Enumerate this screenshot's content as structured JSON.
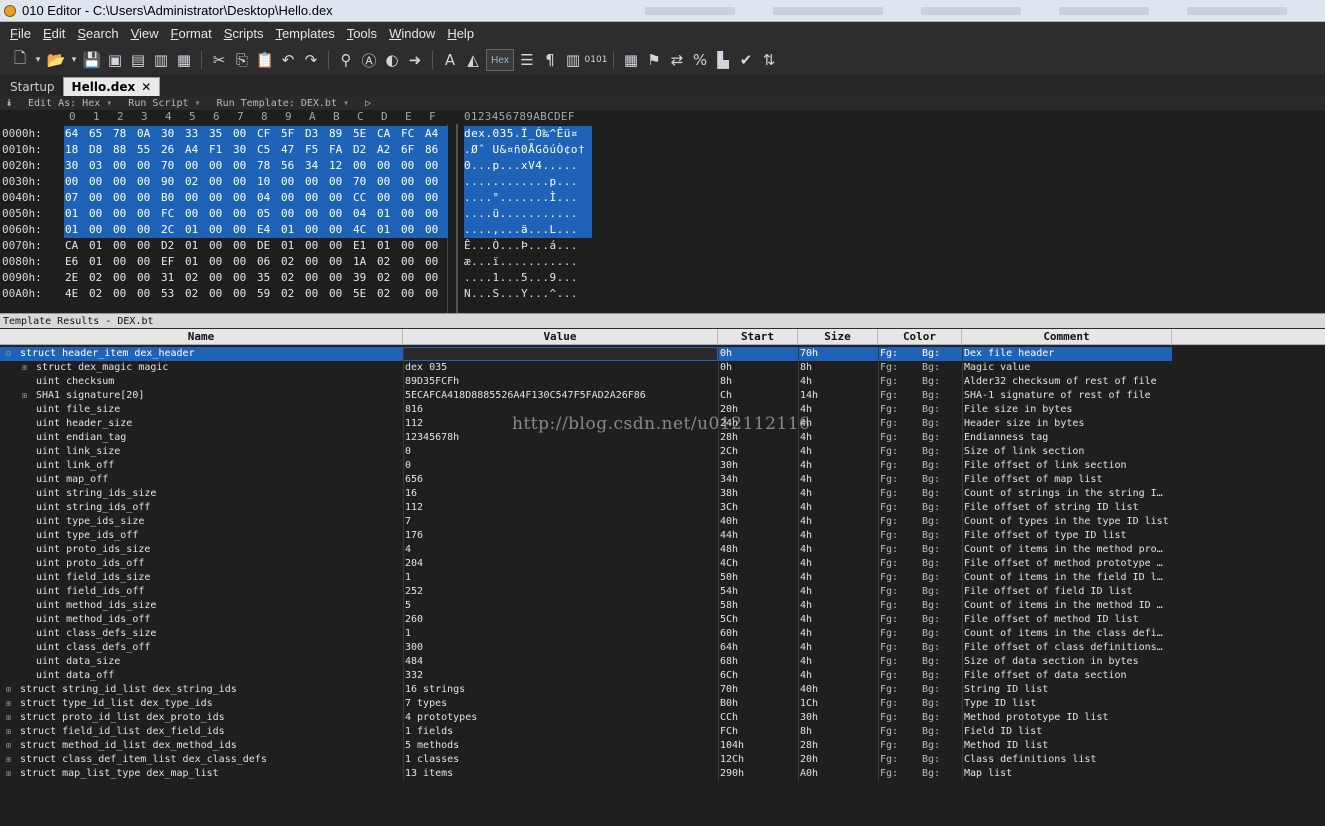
{
  "window": {
    "title": "010 Editor - C:\\Users\\Administrator\\Desktop\\Hello.dex"
  },
  "menu": [
    "File",
    "Edit",
    "Search",
    "View",
    "Format",
    "Scripts",
    "Templates",
    "Tools",
    "Window",
    "Help"
  ],
  "toolbar": {
    "hex_label": "Hex"
  },
  "tabs": [
    {
      "label": "Startup"
    },
    {
      "label": "Hello.dex",
      "active": true
    }
  ],
  "editbar": {
    "edit_as": "Edit As: Hex",
    "run_script": "Run Script",
    "run_template": "Run Template: DEX.bt"
  },
  "hex": {
    "columns": [
      "0",
      "1",
      "2",
      "3",
      "4",
      "5",
      "6",
      "7",
      "8",
      "9",
      "A",
      "B",
      "C",
      "D",
      "E",
      "F"
    ],
    "ascii_header": "0123456789ABCDEF",
    "rows": [
      {
        "addr": "0000h:",
        "bytes": [
          "64",
          "65",
          "78",
          "0A",
          "30",
          "33",
          "35",
          "00",
          "CF",
          "5F",
          "D3",
          "89",
          "5E",
          "CA",
          "FC",
          "A4"
        ],
        "ascii": "dex.035.Ï_Ó‰^Êü¤",
        "sel": true
      },
      {
        "addr": "0010h:",
        "bytes": [
          "18",
          "D8",
          "88",
          "55",
          "26",
          "A4",
          "F1",
          "30",
          "C5",
          "47",
          "F5",
          "FA",
          "D2",
          "A2",
          "6F",
          "86"
        ],
        "ascii": ".Øˆ U&¤ñ0ÅGõúÒ¢o†",
        "sel": true
      },
      {
        "addr": "0020h:",
        "bytes": [
          "30",
          "03",
          "00",
          "00",
          "70",
          "00",
          "00",
          "00",
          "78",
          "56",
          "34",
          "12",
          "00",
          "00",
          "00",
          "00"
        ],
        "ascii": "0...p...xV4.....",
        "sel": true
      },
      {
        "addr": "0030h:",
        "bytes": [
          "00",
          "00",
          "00",
          "00",
          "90",
          "02",
          "00",
          "00",
          "10",
          "00",
          "00",
          "00",
          "70",
          "00",
          "00",
          "00"
        ],
        "ascii": "............p...",
        "sel": true
      },
      {
        "addr": "0040h:",
        "bytes": [
          "07",
          "00",
          "00",
          "00",
          "B0",
          "00",
          "00",
          "00",
          "04",
          "00",
          "00",
          "00",
          "CC",
          "00",
          "00",
          "00"
        ],
        "ascii": "....°.......Ì...",
        "sel": true
      },
      {
        "addr": "0050h:",
        "bytes": [
          "01",
          "00",
          "00",
          "00",
          "FC",
          "00",
          "00",
          "00",
          "05",
          "00",
          "00",
          "00",
          "04",
          "01",
          "00",
          "00"
        ],
        "ascii": "....ü...........",
        "sel": true
      },
      {
        "addr": "0060h:",
        "bytes": [
          "01",
          "00",
          "00",
          "00",
          "2C",
          "01",
          "00",
          "00",
          "E4",
          "01",
          "00",
          "00",
          "4C",
          "01",
          "00",
          "00"
        ],
        "ascii": "....,...ä...L...",
        "sel": true
      },
      {
        "addr": "0070h:",
        "bytes": [
          "CA",
          "01",
          "00",
          "00",
          "D2",
          "01",
          "00",
          "00",
          "DE",
          "01",
          "00",
          "00",
          "E1",
          "01",
          "00",
          "00"
        ],
        "ascii": "Ê...Ò...Þ...á...",
        "sel": false
      },
      {
        "addr": "0080h:",
        "bytes": [
          "E6",
          "01",
          "00",
          "00",
          "EF",
          "01",
          "00",
          "00",
          "06",
          "02",
          "00",
          "00",
          "1A",
          "02",
          "00",
          "00"
        ],
        "ascii": "æ...ï...........",
        "sel": false
      },
      {
        "addr": "0090h:",
        "bytes": [
          "2E",
          "02",
          "00",
          "00",
          "31",
          "02",
          "00",
          "00",
          "35",
          "02",
          "00",
          "00",
          "39",
          "02",
          "00",
          "00"
        ],
        "ascii": "....1...5...9...",
        "sel": false
      },
      {
        "addr": "00A0h:",
        "bytes": [
          "4E",
          "02",
          "00",
          "00",
          "53",
          "02",
          "00",
          "00",
          "59",
          "02",
          "00",
          "00",
          "5E",
          "02",
          "00",
          "00"
        ],
        "ascii": "N...S...Y...^...",
        "sel": false
      }
    ]
  },
  "template": {
    "panel_title": "Template Results - DEX.bt",
    "headers": {
      "name": "Name",
      "value": "Value",
      "start": "Start",
      "size": "Size",
      "color": "Color",
      "comment": "Comment"
    },
    "rows": [
      {
        "name": "struct header_item dex_header",
        "value": "",
        "start": "0h",
        "size": "70h",
        "fg": "Fg:",
        "bg": "Bg:",
        "comment": "Dex file header",
        "level": 0,
        "tw": "open",
        "sel": true
      },
      {
        "name": "struct dex_magic magic",
        "value": "dex 035",
        "start": "0h",
        "size": "8h",
        "fg": "Fg:",
        "bg": "Bg:",
        "comment": "Magic value",
        "level": 1,
        "tw": "closed"
      },
      {
        "name": "uint checksum",
        "value": "89D35FCFh",
        "start": "8h",
        "size": "4h",
        "fg": "Fg:",
        "bg": "Bg:",
        "comment": "Alder32 checksum of rest of file",
        "level": 1
      },
      {
        "name": "SHA1 signature[20]",
        "value": "5ECAFCA418D8885526A4F130C547F5FAD2A26F86",
        "start": "Ch",
        "size": "14h",
        "fg": "Fg:",
        "bg": "Bg:",
        "comment": "SHA-1 signature of rest of file",
        "level": 1,
        "tw": "closed"
      },
      {
        "name": "uint file_size",
        "value": "816",
        "start": "20h",
        "size": "4h",
        "fg": "Fg:",
        "bg": "Bg:",
        "comment": "File size in bytes",
        "level": 1
      },
      {
        "name": "uint header_size",
        "value": "112",
        "start": "24h",
        "size": "4h",
        "fg": "Fg:",
        "bg": "Bg:",
        "comment": "Header size in bytes",
        "level": 1
      },
      {
        "name": "uint endian_tag",
        "value": "12345678h",
        "start": "28h",
        "size": "4h",
        "fg": "Fg:",
        "bg": "Bg:",
        "comment": "Endianness tag",
        "level": 1
      },
      {
        "name": "uint link_size",
        "value": "0",
        "start": "2Ch",
        "size": "4h",
        "fg": "Fg:",
        "bg": "Bg:",
        "comment": "Size of link section",
        "level": 1
      },
      {
        "name": "uint link_off",
        "value": "0",
        "start": "30h",
        "size": "4h",
        "fg": "Fg:",
        "bg": "Bg:",
        "comment": "File offset of link section",
        "level": 1
      },
      {
        "name": "uint map_off",
        "value": "656",
        "start": "34h",
        "size": "4h",
        "fg": "Fg:",
        "bg": "Bg:",
        "comment": "File offset of map list",
        "level": 1
      },
      {
        "name": "uint string_ids_size",
        "value": "16",
        "start": "38h",
        "size": "4h",
        "fg": "Fg:",
        "bg": "Bg:",
        "comment": "Count of strings in the string I…",
        "level": 1
      },
      {
        "name": "uint string_ids_off",
        "value": "112",
        "start": "3Ch",
        "size": "4h",
        "fg": "Fg:",
        "bg": "Bg:",
        "comment": "File offset of string ID list",
        "level": 1
      },
      {
        "name": "uint type_ids_size",
        "value": "7",
        "start": "40h",
        "size": "4h",
        "fg": "Fg:",
        "bg": "Bg:",
        "comment": "Count of types in the type ID list",
        "level": 1
      },
      {
        "name": "uint type_ids_off",
        "value": "176",
        "start": "44h",
        "size": "4h",
        "fg": "Fg:",
        "bg": "Bg:",
        "comment": "File offset of type ID list",
        "level": 1
      },
      {
        "name": "uint proto_ids_size",
        "value": "4",
        "start": "48h",
        "size": "4h",
        "fg": "Fg:",
        "bg": "Bg:",
        "comment": "Count of items in the method pro…",
        "level": 1
      },
      {
        "name": "uint proto_ids_off",
        "value": "204",
        "start": "4Ch",
        "size": "4h",
        "fg": "Fg:",
        "bg": "Bg:",
        "comment": "File offset of method prototype …",
        "level": 1
      },
      {
        "name": "uint field_ids_size",
        "value": "1",
        "start": "50h",
        "size": "4h",
        "fg": "Fg:",
        "bg": "Bg:",
        "comment": "Count of items in the field ID l…",
        "level": 1
      },
      {
        "name": "uint field_ids_off",
        "value": "252",
        "start": "54h",
        "size": "4h",
        "fg": "Fg:",
        "bg": "Bg:",
        "comment": "File offset of field ID list",
        "level": 1
      },
      {
        "name": "uint method_ids_size",
        "value": "5",
        "start": "58h",
        "size": "4h",
        "fg": "Fg:",
        "bg": "Bg:",
        "comment": "Count of items in the method ID …",
        "level": 1
      },
      {
        "name": "uint method_ids_off",
        "value": "260",
        "start": "5Ch",
        "size": "4h",
        "fg": "Fg:",
        "bg": "Bg:",
        "comment": "File offset of method ID list",
        "level": 1
      },
      {
        "name": "uint class_defs_size",
        "value": "1",
        "start": "60h",
        "size": "4h",
        "fg": "Fg:",
        "bg": "Bg:",
        "comment": "Count of items in the class defi…",
        "level": 1
      },
      {
        "name": "uint class_defs_off",
        "value": "300",
        "start": "64h",
        "size": "4h",
        "fg": "Fg:",
        "bg": "Bg:",
        "comment": "File offset of class definitions…",
        "level": 1
      },
      {
        "name": "uint data_size",
        "value": "484",
        "start": "68h",
        "size": "4h",
        "fg": "Fg:",
        "bg": "Bg:",
        "comment": "Size of data section in bytes",
        "level": 1
      },
      {
        "name": "uint data_off",
        "value": "332",
        "start": "6Ch",
        "size": "4h",
        "fg": "Fg:",
        "bg": "Bg:",
        "comment": "File offset of data section",
        "level": 1
      },
      {
        "name": "struct string_id_list dex_string_ids",
        "value": "16 strings",
        "start": "70h",
        "size": "40h",
        "fg": "Fg:",
        "bg": "Bg:",
        "comment": "String ID list",
        "level": 0,
        "tw": "closed"
      },
      {
        "name": "struct type_id_list dex_type_ids",
        "value": "7 types",
        "start": "B0h",
        "size": "1Ch",
        "fg": "Fg:",
        "bg": "Bg:",
        "comment": "Type ID list",
        "level": 0,
        "tw": "closed"
      },
      {
        "name": "struct proto_id_list dex_proto_ids",
        "value": "4 prototypes",
        "start": "CCh",
        "size": "30h",
        "fg": "Fg:",
        "bg": "Bg:",
        "comment": "Method prototype ID list",
        "level": 0,
        "tw": "closed"
      },
      {
        "name": "struct field_id_list dex_field_ids",
        "value": "1 fields",
        "start": "FCh",
        "size": "8h",
        "fg": "Fg:",
        "bg": "Bg:",
        "comment": "Field ID list",
        "level": 0,
        "tw": "closed"
      },
      {
        "name": "struct method_id_list dex_method_ids",
        "value": "5 methods",
        "start": "104h",
        "size": "28h",
        "fg": "Fg:",
        "bg": "Bg:",
        "comment": "Method ID list",
        "level": 0,
        "tw": "closed"
      },
      {
        "name": "struct class_def_item_list dex_class_defs",
        "value": "1 classes",
        "start": "12Ch",
        "size": "20h",
        "fg": "Fg:",
        "bg": "Bg:",
        "comment": "Class definitions list",
        "level": 0,
        "tw": "closed"
      },
      {
        "name": "struct map_list_type dex_map_list",
        "value": "13 items",
        "start": "290h",
        "size": "A0h",
        "fg": "Fg:",
        "bg": "Bg:",
        "comment": "Map list",
        "level": 0,
        "tw": "closed"
      }
    ]
  },
  "watermark": "http://blog.csdn.net/u012112116",
  "colors": {
    "selection": "#1e63b8",
    "background": "#1e1e1e"
  }
}
